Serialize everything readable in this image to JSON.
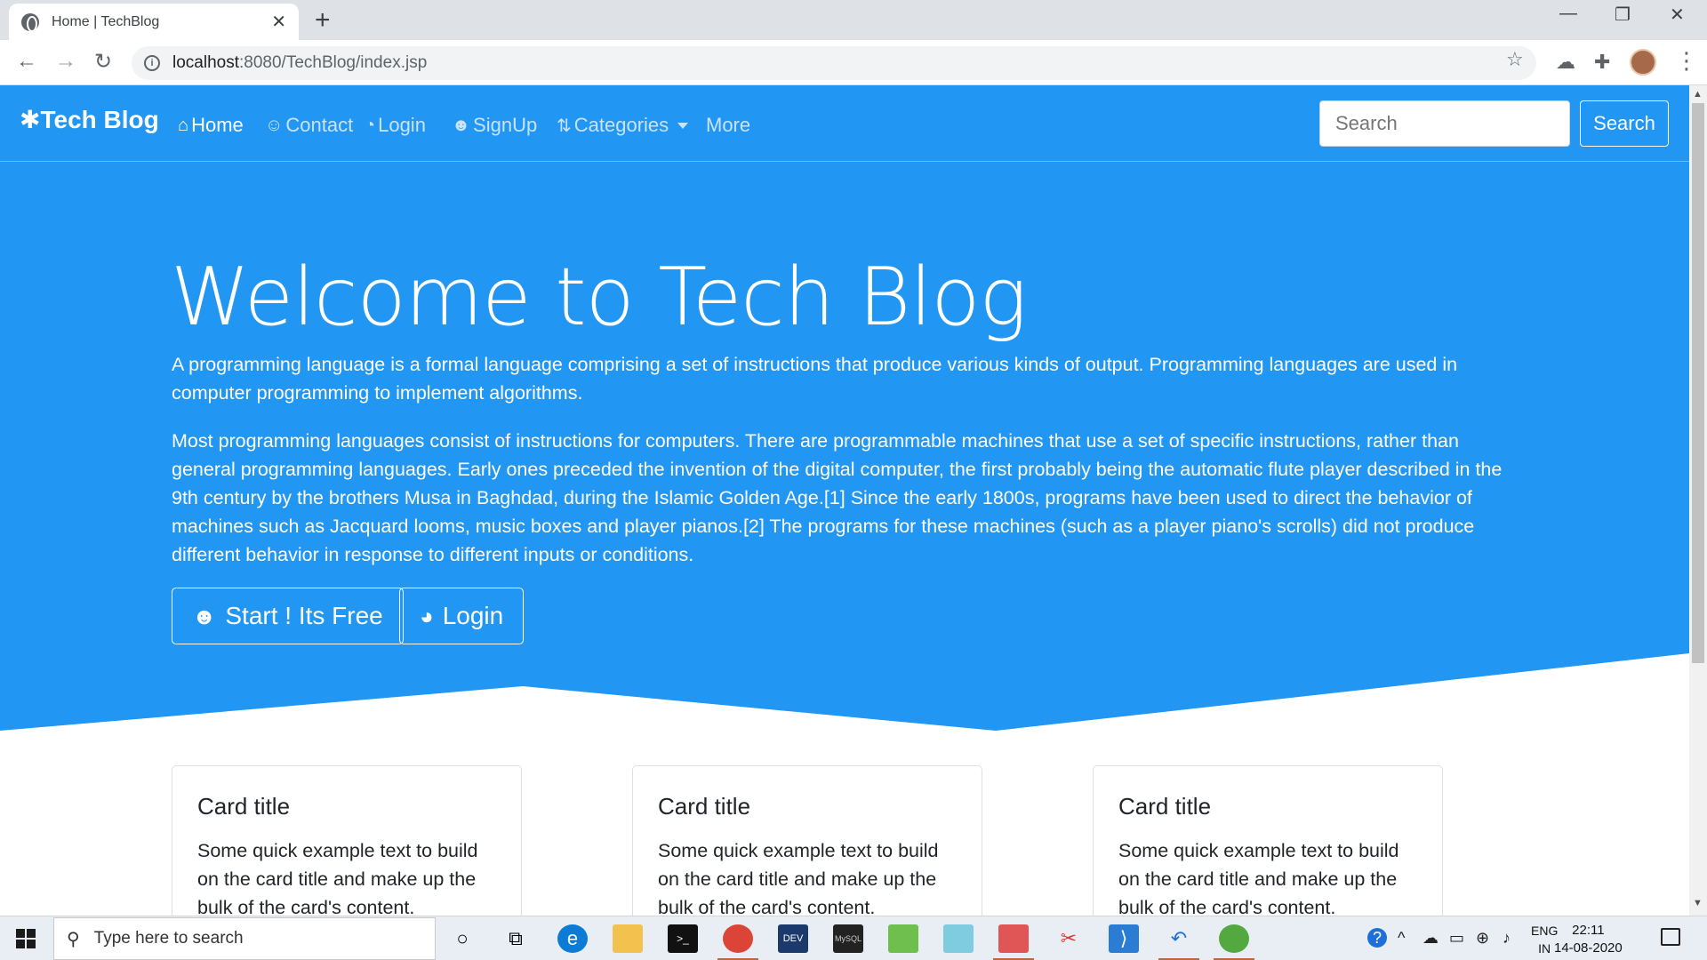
{
  "browser": {
    "tab_title": "Home | TechBlog",
    "tab_close": "✕",
    "new_tab": "+",
    "url_host": "localhost",
    "url_rest": ":8080/TechBlog/index.jsp",
    "window_minimize": "—",
    "window_restore": "❐",
    "window_close": "✕"
  },
  "navbar": {
    "brand": "Tech Blog",
    "links": [
      {
        "label": "Home",
        "icon": "home-icon",
        "active": true
      },
      {
        "label": "Contact",
        "icon": "contact-icon",
        "active": false
      },
      {
        "label": "Login",
        "icon": "login-icon",
        "active": false
      },
      {
        "label": "SignUp",
        "icon": "signup-icon",
        "active": false
      },
      {
        "label": "Categories",
        "icon": "sort-icon",
        "active": false
      },
      {
        "label": "More",
        "icon": "",
        "active": false
      }
    ],
    "search_placeholder": "Search",
    "search_button": "Search"
  },
  "hero": {
    "title": "Welcome to Tech Blog",
    "paragraph1": "A programming language is a formal language comprising a set of instructions that produce various kinds of output. Programming languages are used in computer programming to implement algorithms.",
    "paragraph2": "Most programming languages consist of instructions for computers. There are programmable machines that use a set of specific instructions, rather than general programming languages. Early ones preceded the invention of the digital computer, the first probably being the automatic flute player described in the 9th century by the brothers Musa in Baghdad, during the Islamic Golden Age.[1] Since the early 1800s, programs have been used to direct the behavior of machines such as Jacquard looms, music boxes and player pianos.[2] The programs for these machines (such as a player piano's scrolls) did not produce different behavior in response to different inputs or conditions.",
    "start_button": "Start ! Its Free",
    "login_button": "Login"
  },
  "cards": [
    {
      "title": "Card title",
      "text": "Some quick example text to build on the card title and make up the bulk of the card's content."
    },
    {
      "title": "Card title",
      "text": "Some quick example text to build on the card title and make up the bulk of the card's content."
    },
    {
      "title": "Card title",
      "text": "Some quick example text to build on the card title and make up the bulk of the card's content."
    }
  ],
  "taskbar": {
    "search_placeholder": "Type here to search",
    "lang_top": "ENG",
    "lang_bottom": "IN",
    "time": "22:11",
    "date": "14-08-2020"
  },
  "colors": {
    "primary": "#2196f3",
    "nav_inactive": "#c8e3fb"
  }
}
